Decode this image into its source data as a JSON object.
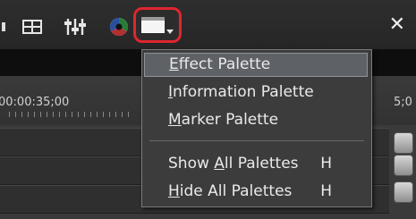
{
  "toolbar": {
    "icons": [
      "grid-icon",
      "mixer-sliders-icon",
      "color-wheel-icon",
      "palette-window-icon",
      "close-icon"
    ],
    "close_label": "✕",
    "highlight_color": "#e0252f"
  },
  "timeline": {
    "timecode_left": "00:00:35;00",
    "timecode_right": "5;0"
  },
  "menu": {
    "items": [
      {
        "accel": "E",
        "rest": "ffect Palette",
        "pre": ""
      },
      {
        "accel": "I",
        "rest": "nformation Palette",
        "pre": ""
      },
      {
        "accel": "M",
        "rest": "arker Palette",
        "pre": ""
      },
      {
        "pre": "Show ",
        "accel": "A",
        "rest": "ll Palettes",
        "shortcut": "H"
      },
      {
        "pre": "",
        "accel": "H",
        "rest": "ide All Palettes",
        "shortcut": "H"
      }
    ]
  }
}
